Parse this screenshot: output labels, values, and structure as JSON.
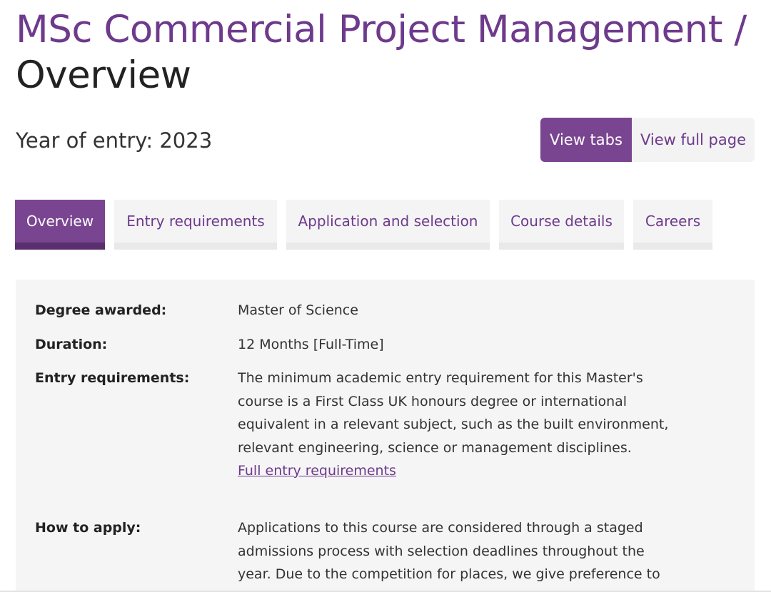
{
  "header": {
    "breadcrumb": "MSc Commercial Project Management /",
    "page_title": "Overview",
    "year_of_entry": "Year of entry: 2023"
  },
  "view_toggle": {
    "tabs_label": "View tabs",
    "full_page_label": "View full page"
  },
  "tabs": [
    {
      "label": "Overview",
      "active": true
    },
    {
      "label": "Entry requirements",
      "active": false
    },
    {
      "label": "Application and selection",
      "active": false
    },
    {
      "label": "Course details",
      "active": false
    },
    {
      "label": "Careers",
      "active": false
    }
  ],
  "summary": [
    {
      "label": "Degree awarded:",
      "value": "Master of Science"
    },
    {
      "label": "Duration:",
      "value": "12 Months [Full-Time]"
    },
    {
      "label": "Entry requirements:",
      "value": "The minimum academic entry requirement for this Master's course is a First Class UK honours degree or international equivalent in a relevant subject, such as the built environment, relevant engineering, science or management disciplines.",
      "link": "Full entry requirements"
    },
    {
      "label": "How to apply:",
      "value": "Applications to this course are considered through a staged admissions process with selection deadlines throughout the year. Due to the competition for places, we give preference to"
    }
  ],
  "colors": {
    "accent": "#7a4590",
    "accent_text": "#6e3a8c",
    "panel_bg": "#f5f5f5"
  }
}
